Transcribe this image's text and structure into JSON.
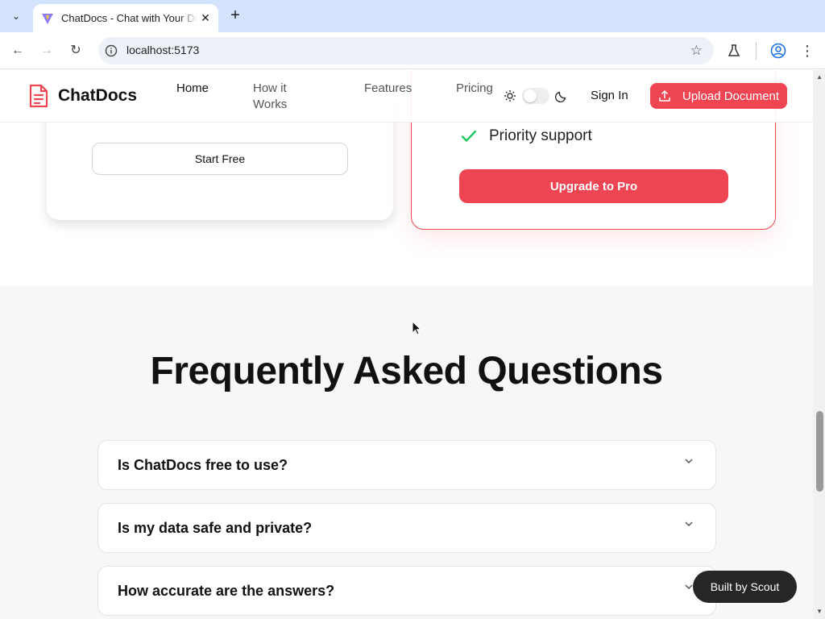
{
  "browser": {
    "tab_title": "ChatDocs - Chat with Your Documents",
    "url": "localhost:5173"
  },
  "header": {
    "brand": "ChatDocs",
    "nav": [
      "Home",
      "How it Works",
      "Features",
      "Pricing"
    ],
    "sign_in": "Sign In",
    "upload": "Upload Document"
  },
  "pricing": {
    "free_button": "Start Free",
    "pro_feature": "Priority support",
    "pro_button": "Upgrade to Pro"
  },
  "faq": {
    "title": "Frequently Asked Questions",
    "items": [
      "Is ChatDocs free to use?",
      "Is my data safe and private?",
      "How accurate are the answers?"
    ]
  },
  "badge": {
    "label": "Built by Scout"
  },
  "colors": {
    "accent": "#ef4452",
    "check": "#22c55e"
  }
}
